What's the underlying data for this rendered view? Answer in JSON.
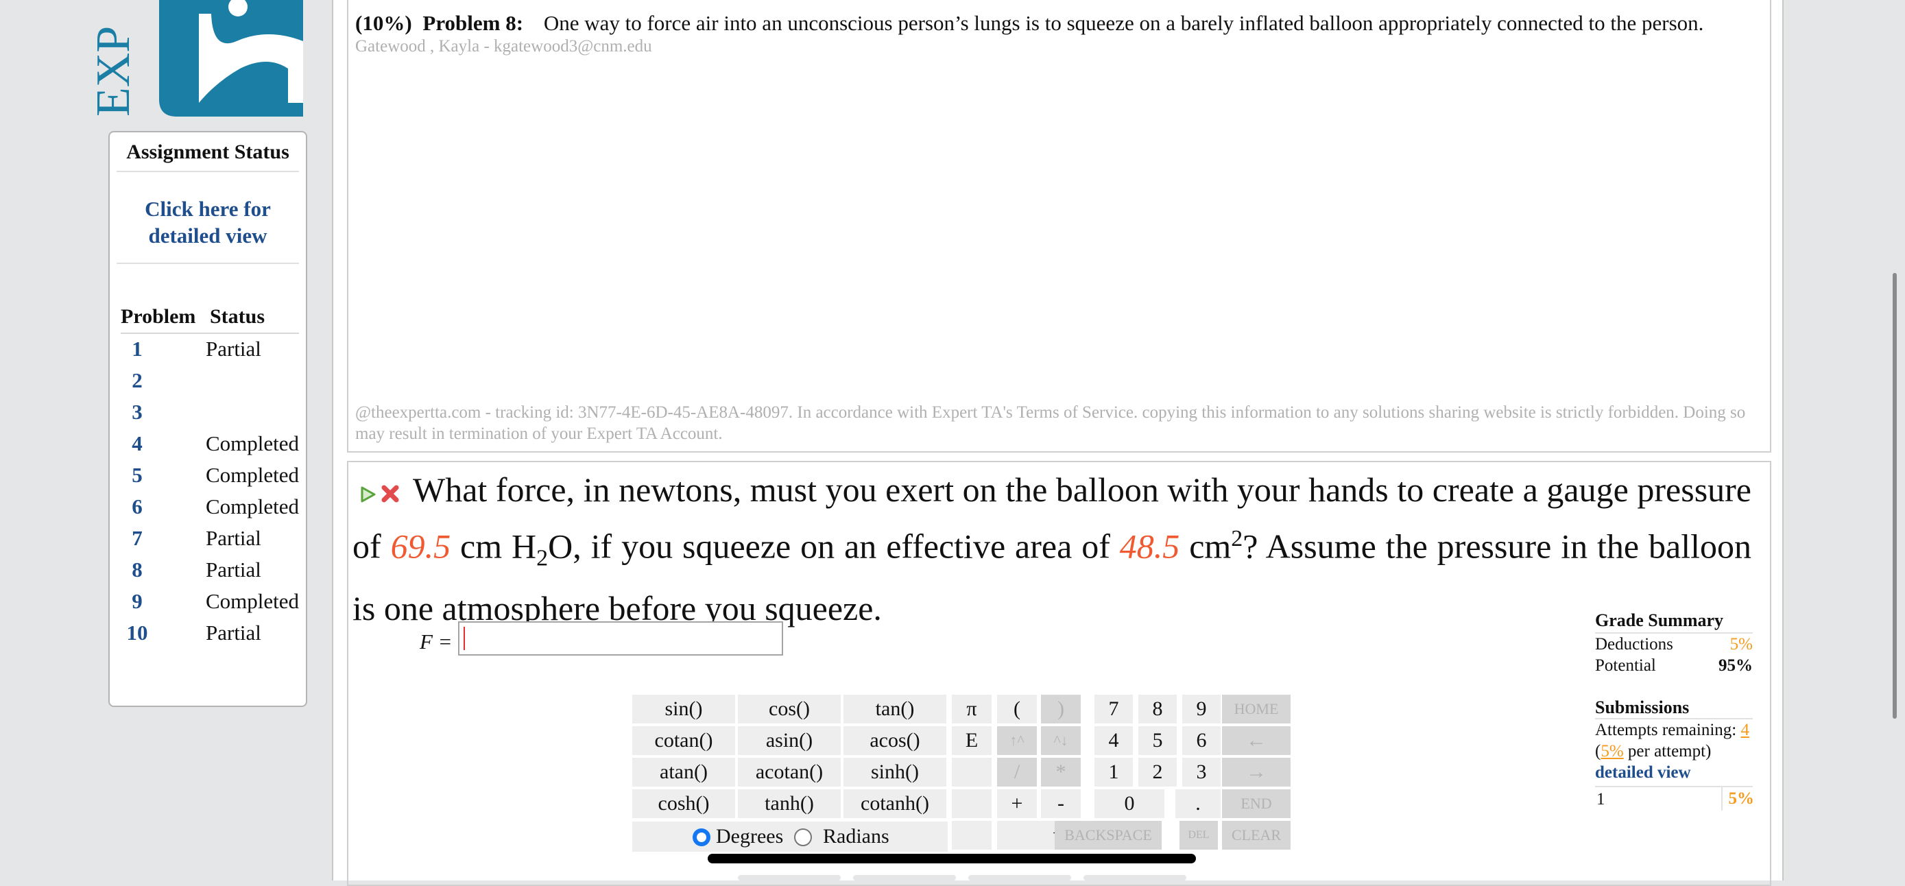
{
  "logo": {
    "text": "EXP"
  },
  "status_panel": {
    "title": "Assignment Status",
    "detail_link": "Click here for detailed view",
    "col_problem": "Problem",
    "col_status": "Status",
    "rows": [
      {
        "num": "1",
        "status": "Partial"
      },
      {
        "num": "2",
        "status": ""
      },
      {
        "num": "3",
        "status": ""
      },
      {
        "num": "4",
        "status": "Completed"
      },
      {
        "num": "5",
        "status": "Completed"
      },
      {
        "num": "6",
        "status": "Completed"
      },
      {
        "num": "7",
        "status": "Partial"
      },
      {
        "num": "8",
        "status": "Partial"
      },
      {
        "num": "9",
        "status": "Completed"
      },
      {
        "num": "10",
        "status": "Partial"
      }
    ]
  },
  "problem": {
    "weight": "(10%)",
    "number_label": "Problem 8:",
    "intro": "One way to force air into an unconscious person’s lungs is to squeeze on a barely inflated balloon appropriately connected to the person.",
    "student": "Gatewood , Kayla - kgatewood3@cnm.edu",
    "tracking": "@theexpertta.com - tracking id: 3N77-4E-6D-45-AE8A-48097. In accordance with Expert TA's Terms of Service. copying this information to any solutions sharing website is strictly forbidden. Doing so may result in termination of your Expert TA Account."
  },
  "question": {
    "part1": "What force, in newtons, must you exert on the balloon with your hands to create a gauge pressure of ",
    "value1": "69.5",
    "part2": " cm H",
    "sub2": "2",
    "part3": "O, if you squeeze on an effective area of ",
    "value2": "48.5",
    "part4": " cm",
    "sup2": "2",
    "part5": "? Assume the pressure in the balloon is one atmosphere before you squeeze.",
    "answer_var": "F =",
    "answer_value": ""
  },
  "keypad": {
    "functions": [
      "sin()",
      "cos()",
      "tan()",
      "cotan()",
      "asin()",
      "acos()",
      "atan()",
      "acotan()",
      "sinh()",
      "cosh()",
      "tanh()",
      "cotanh()"
    ],
    "pi": "π",
    "e": "E",
    "open_paren": "(",
    "close_paren": ")",
    "up_arrow": "↑^",
    "down_arrow": "^↓",
    "divide": "/",
    "multiply": "*",
    "plus": "+",
    "minus": "-",
    "sqrt": "√()",
    "digits": [
      "7",
      "8",
      "9",
      "4",
      "5",
      "6",
      "1",
      "2",
      "3",
      "0"
    ],
    "dot": ".",
    "home": "HOME",
    "left": "←",
    "right": "→",
    "end": "END",
    "backspace": "BACKSPACE",
    "del": "DEL",
    "clear": "CLEAR",
    "degrees": "Degrees",
    "radians": "Radians",
    "angle_mode": "Degrees"
  },
  "grade_summary": {
    "title": "Grade Summary",
    "deductions_label": "Deductions",
    "deductions_value": "5%",
    "potential_label": "Potential",
    "potential_value": "95%"
  },
  "submissions": {
    "title": "Submissions",
    "attempts_label": "Attempts remaining:",
    "attempts_value": "4",
    "per_attempt_open": "(",
    "per_attempt_value": "5%",
    "per_attempt_text": " per attempt)",
    "detail_link": "detailed view",
    "row_num": "1",
    "row_value": "5%"
  },
  "colors": {
    "given_value": "#ef5a32",
    "link": "#1f4e8c",
    "deduction": "#f49b20",
    "logo": "#1b7ea4"
  },
  "icons": {
    "hint": "triangle-play-icon",
    "give_up": "red-x-icon",
    "radio_selected": "radio-on-icon"
  }
}
